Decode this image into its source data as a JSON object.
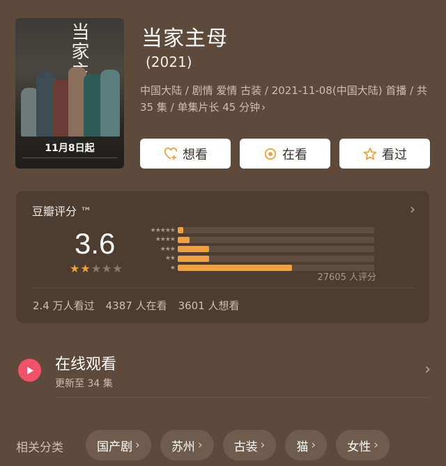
{
  "header": {
    "poster": {
      "title_text": "当家主母",
      "date_text": "11月8日起"
    },
    "title": "当家主母",
    "year": "(2021)",
    "meta": "中国大陆 / 剧情 爱情 古装 / 2021-11-08(中国大陆) 首播 / 共 35 集 / 单集片长 45 分钟",
    "meta_chevron": "›",
    "actions": [
      {
        "label": "想看",
        "icon": "heart-plus-icon"
      },
      {
        "label": "在看",
        "icon": "circle-dot-icon"
      },
      {
        "label": "看过",
        "icon": "star-outline-icon"
      }
    ]
  },
  "rating": {
    "title": "豆瓣评分 ™",
    "chevron": "›",
    "score": "3.6",
    "star_value": 2,
    "star_max": 5,
    "distribution": [
      {
        "stars": "★★★★★",
        "fraction": 0.03
      },
      {
        "stars": "★★★★",
        "fraction": 0.06
      },
      {
        "stars": "★★★",
        "fraction": 0.16
      },
      {
        "stars": "★★",
        "fraction": 0.16
      },
      {
        "stars": "★",
        "fraction": 0.58
      }
    ],
    "count": "27605 人评分",
    "stats": [
      "2.4 万人看过",
      "4387 人在看",
      "3601 人想看"
    ]
  },
  "online": {
    "title": "在线观看",
    "subtitle": "更新至 34 集",
    "chevron": "›"
  },
  "tags": {
    "label": "相关分类",
    "items": [
      "国产剧",
      "苏州",
      "古装",
      "猫",
      "女性"
    ]
  },
  "colors": {
    "background": "#5d4a3b",
    "card": "#4d3d31",
    "accent_bar": "#f0a03c",
    "star_filled": "#f0a03c",
    "star_empty": "#8b7a6b",
    "play_button": "#f2516a"
  }
}
